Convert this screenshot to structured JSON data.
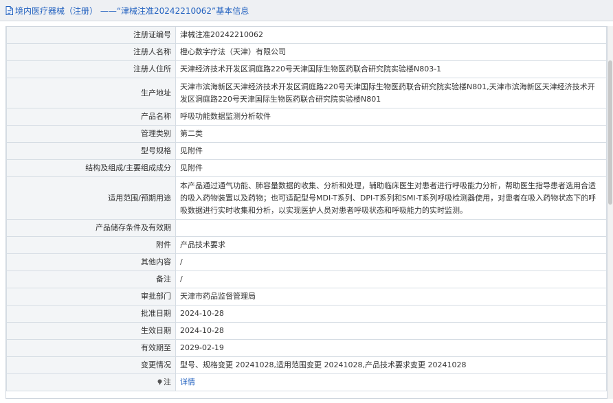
{
  "header": {
    "title": "境内医疗器械（注册） ——“津械注准20242210062”基本信息"
  },
  "rows": [
    {
      "label": "注册证编号",
      "value": "津械注准20242210062"
    },
    {
      "label": "注册人名称",
      "value": "橙心数字疗法（天津）有限公司"
    },
    {
      "label": "注册人住所",
      "value": "天津经济技术开发区洞庭路220号天津国际生物医药联合研究院实验楼N803-1"
    },
    {
      "label": "生产地址",
      "value": "天津市滨海新区天津经济技术开发区洞庭路220号天津国际生物医药联合研究院实验楼N801,天津市滨海新区天津经济技术开发区洞庭路220号天津国际生物医药联合研究院实验楼N801"
    },
    {
      "label": "产品名称",
      "value": "呼吸功能数据监测分析软件"
    },
    {
      "label": "管理类别",
      "value": "第二类"
    },
    {
      "label": "型号规格",
      "value": "见附件"
    },
    {
      "label": "结构及组成/主要组成成分",
      "value": "见附件"
    },
    {
      "label": "适用范围/预期用途",
      "value": "本产品通过通气功能、肺容量数据的收集、分析和处理，辅助临床医生对患者进行呼吸能力分析，帮助医生指导患者选用合适的吸入药物装置以及药物；也可适配型号MDI-T系列、DPI-T系列和SMI-T系列呼吸检测器使用，对患者在吸入药物状态下的呼吸数据进行实时收集和分析，以实现医护人员对患者呼吸状态和呼吸能力的实时监测。"
    },
    {
      "label": "产品储存条件及有效期",
      "value": ""
    },
    {
      "label": "附件",
      "value": "产品技术要求"
    },
    {
      "label": "其他内容",
      "value": "/"
    },
    {
      "label": "备注",
      "value": "/"
    },
    {
      "label": "审批部门",
      "value": "天津市药品监督管理局"
    },
    {
      "label": "批准日期",
      "value": "2024-10-28"
    },
    {
      "label": "生效日期",
      "value": "2024-10-28"
    },
    {
      "label": "有效期至",
      "value": "2029-02-19"
    },
    {
      "label": "变更情况",
      "value": "型号、规格变更 20241028,适用范围变更 20241028,产品技术要求变更 20241028"
    }
  ],
  "note_row": {
    "label": "注",
    "link_text": "详情",
    "icon": "pin-icon"
  },
  "colors": {
    "title": "#1f5fbf",
    "label_bg": "#f3f5f7",
    "border": "#d6dde4"
  }
}
